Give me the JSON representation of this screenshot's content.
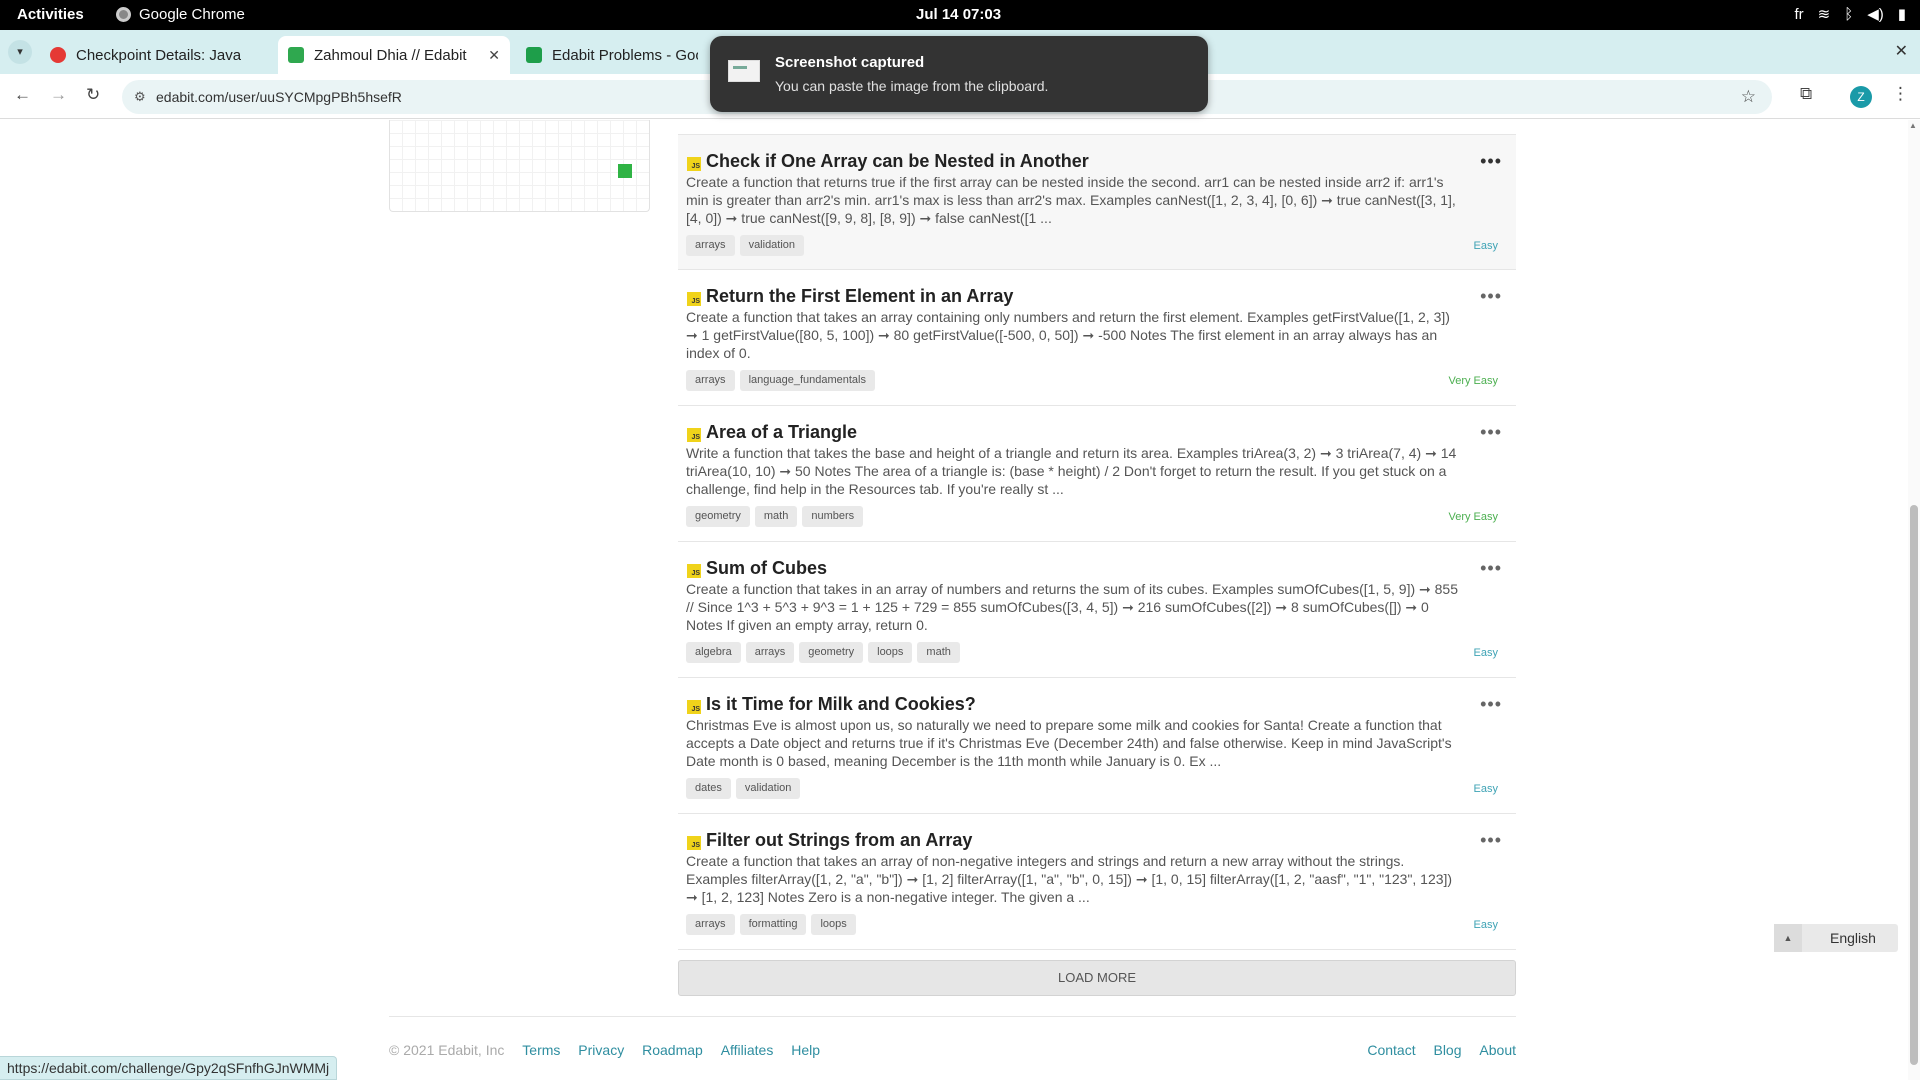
{
  "os_bar": {
    "activities": "Activities",
    "app_name": "Google Chrome",
    "clock": "Jul 14  07:03",
    "keyboard": "fr"
  },
  "browser": {
    "tabs": [
      {
        "title": "Checkpoint Details: Java",
        "favicon_color": "#e53935"
      },
      {
        "title": "Zahmoul Dhia // Edabit",
        "favicon_color": "#2fa84f"
      },
      {
        "title": "Edabit Problems - Goog",
        "favicon_color": "#1e9e4a"
      }
    ],
    "url": "edabit.com/user/uuSYCMpgPBh5hsefR",
    "profile_initial": "Z",
    "status_url": "https://edabit.com/challenge/Gpy2qSFnfhGJnWMMj"
  },
  "notification": {
    "title": "Screenshot captured",
    "body": "You can paste the image from the clipboard."
  },
  "challenges": [
    {
      "badge": "JS",
      "title": "Check if One Array can be Nested in Another",
      "description": "Create a function that returns true if the first array can be nested inside the second. arr1 can be nested inside arr2 if: arr1's min is greater than arr2's min. arr1's max is less than arr2's max. Examples canNest([1, 2, 3, 4], [0, 6]) ➞ true canNest([3, 1], [4, 0]) ➞ true canNest([9, 9, 8], [8, 9]) ➞ false canNest([1 ...",
      "tags": [
        "arrays",
        "validation"
      ],
      "difficulty": "Easy",
      "difficulty_color": "#3fa3b5"
    },
    {
      "badge": "JS",
      "title": "Return the First Element in an Array",
      "description": "Create a function that takes an array containing only numbers and return the first element. Examples getFirstValue([1, 2, 3]) ➞ 1 getFirstValue([80, 5, 100]) ➞ 80 getFirstValue([-500, 0, 50]) ➞ -500 Notes The first element in an array always has an index of 0.",
      "tags": [
        "arrays",
        "language_fundamentals"
      ],
      "difficulty": "Very Easy",
      "difficulty_color": "#4caf50"
    },
    {
      "badge": "JS",
      "title": "Area of a Triangle",
      "description": "Write a function that takes the base and height of a triangle and return its area. Examples triArea(3, 2) ➞ 3 triArea(7, 4) ➞ 14 triArea(10, 10) ➞ 50 Notes The area of a triangle is: (base * height) / 2 Don't forget to return the result. If you get stuck on a challenge, find help in the Resources tab. If you're really st ...",
      "tags": [
        "geometry",
        "math",
        "numbers"
      ],
      "difficulty": "Very Easy",
      "difficulty_color": "#4caf50"
    },
    {
      "badge": "JS",
      "title": "Sum of Cubes",
      "description": "Create a function that takes in an array of numbers and returns the sum of its cubes. Examples sumOfCubes([1, 5, 9]) ➞ 855 // Since 1^3 + 5^3 + 9^3 = 1 + 125 + 729 = 855 sumOfCubes([3, 4, 5]) ➞ 216 sumOfCubes([2]) ➞ 8 sumOfCubes([]) ➞ 0 Notes If given an empty array, return 0.",
      "tags": [
        "algebra",
        "arrays",
        "geometry",
        "loops",
        "math"
      ],
      "difficulty": "Easy",
      "difficulty_color": "#3fa3b5"
    },
    {
      "badge": "JS",
      "title": "Is it Time for Milk and Cookies?",
      "description": "Christmas Eve is almost upon us, so naturally we need to prepare some milk and cookies for Santa! Create a function that accepts a Date object and returns true if it's Christmas Eve (December 24th) and false otherwise. Keep in mind JavaScript's Date month is 0 based, meaning December is the 11th month while January is 0. Ex ...",
      "tags": [
        "dates",
        "validation"
      ],
      "difficulty": "Easy",
      "difficulty_color": "#3fa3b5"
    },
    {
      "badge": "JS",
      "title": "Filter out Strings from an Array",
      "description": "Create a function that takes an array of non-negative integers and strings and return a new array without the strings. Examples filterArray([1, 2, \"a\", \"b\"]) ➞ [1, 2] filterArray([1, \"a\", \"b\", 0, 15]) ➞ [1, 0, 15] filterArray([1, 2, \"aasf\", \"1\", \"123\", 123]) ➞ [1, 2, 123] Notes Zero is a non-negative integer. The given a ...",
      "tags": [
        "arrays",
        "formatting",
        "loops"
      ],
      "difficulty": "Easy",
      "difficulty_color": "#3fa3b5"
    }
  ],
  "load_more": "LOAD MORE",
  "footer": {
    "copyright": "© 2021 Edabit, Inc",
    "links_left": [
      "Terms",
      "Privacy",
      "Roadmap",
      "Affiliates",
      "Help"
    ],
    "links_right": [
      "Contact",
      "Blog",
      "About"
    ],
    "language": "English"
  }
}
